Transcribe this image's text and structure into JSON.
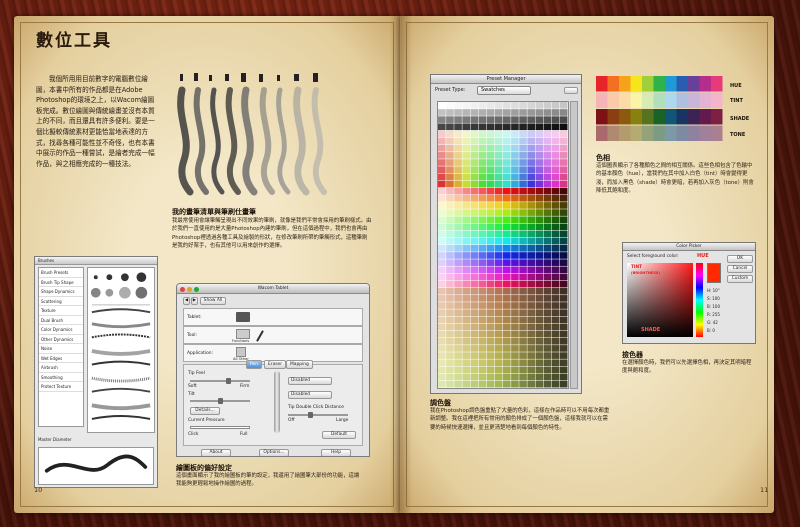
{
  "left_page": {
    "title": "數位工具",
    "intro": "我個所用用目前數字的電腦數位繪圖，本書中所有的作品都是在Adobe Photoshop的環境之上，以Wacom繪圖板完成。數位繪圖與傳統繪畫並沒有本質上的不同，而且還具有許多便利。要是一個比擬較傳統素材更能恰當地表達的方式，找尋各種可能性並不奇怪，也有本書中展示的作品一種嘗試，是繪者完成一幅作品，與之相應完成的一種技法。",
    "brush_caption_title": "我的畫筆清單與筆刷仕畫筆",
    "brush_caption_body": "我最常使用會讓筆觸呈現出不同效果的筆刷，就像是我們平常會採用的筆刷樣式。由於我們一直使用的是大量Photoshop內建的筆刷，但在這個過程中，我們也會再由Photoshop裡透過各種工具及繪製的形狀，在修改筆刷所帶的筆觸形式，這種筆刷是我的好幫手，也有其他可以用來創作的選擇。",
    "wacom_caption_title": "繪圖板的偏好設定",
    "wacom_caption_body": "這個畫面顯示了我的繪圖板的筆的設定，我還用了繪圖筆大部份的功能，這讓我能夠更輕鬆地操作繪圖的過程。",
    "page_number": "10"
  },
  "brush_panel": {
    "title": "Brushes",
    "items": [
      "Brush Presets",
      "Brush Tip Shape",
      "Shape Dynamics",
      "Scattering",
      "Texture",
      "Dual Brush",
      "Color Dynamics",
      "Other Dynamics",
      "Noise",
      "Wet Edges",
      "Airbrush",
      "Smoothing",
      "Protect Texture"
    ],
    "diameter_label": "Master Diameter"
  },
  "wacom": {
    "title": "Wacom Tablet",
    "show_all": "Show All",
    "row_labels": [
      "Tablet:",
      "Tool:",
      "Application:"
    ],
    "tool_name": "Functions",
    "app_name": "All Other",
    "tabs": [
      "Pen",
      "Eraser",
      "Mapping"
    ],
    "tip_feel": "Tip Feel",
    "soft": "Soft",
    "firm": "Firm",
    "tilt": "Tilt",
    "details": "Details...",
    "current_pressure": "Current Pressure",
    "click": "Click",
    "full": "Full",
    "dropdown_1": "Disabled",
    "dropdown_2": "Disabled",
    "double_click": "Tip Double Click Distance",
    "off": "Off",
    "large": "Large",
    "default": "Default",
    "about": "About",
    "options": "Options...",
    "help": "Help"
  },
  "right_page": {
    "palette_caption_title": "調色盤",
    "palette_caption_body": "我在Photoshop調色盤重點了大量的色彩，這樣在作品時可以不用每次都重新調整。我在這裡把所有常用的顏色排成了一個顏色盤，這樣我就可以在需要的時候快速選擇，並且更清楚地看到每個顏色的特性。",
    "colorchart_caption_title": "色相",
    "colorchart_caption_body": "這個圖表顯示了各種顏色之間的相互關係。這些色相包含了色輪中的基本顏色（hue），當我們在其中加入白色（tint）時會變得更淺，而加入黑色（shade）時會更暗，若再加入灰色（tone）則會降低其飽和度。",
    "picker_caption_title": "撿色器",
    "picker_caption_body": "在選擇顏色時，我們可以先選擇色相，再決定其明暗程度與飽和度。",
    "page_number": "11"
  },
  "preset_manager": {
    "title": "Preset Manager",
    "type_label": "Preset Type:",
    "type_value": "Swatches"
  },
  "color_chart": {
    "labels": [
      "HUE",
      "TINT",
      "SHADE",
      "TONE"
    ],
    "hue": [
      "#e8242b",
      "#f36f22",
      "#f7a21b",
      "#f6e51a",
      "#9fcf3a",
      "#2db34a",
      "#1e9bd7",
      "#2a5db0",
      "#6a3f99",
      "#b52e8c",
      "#e63b7a"
    ],
    "tint": [
      "#f6b4b6",
      "#fbcaa8",
      "#fcdca6",
      "#fbf3a6",
      "#d7ebb4",
      "#b1dfbd",
      "#aed8ef",
      "#aebfe0",
      "#c8b6da",
      "#e3b3d4",
      "#f4b5cc"
    ],
    "shade": [
      "#7d1216",
      "#8a3e12",
      "#8b5a0f",
      "#8a800f",
      "#57731f",
      "#196328",
      "#0f5678",
      "#173463",
      "#3b2355",
      "#651a4e",
      "#7e2043"
    ],
    "tone": [
      "#a86a6c",
      "#b08a6f",
      "#b39b6e",
      "#b3ab70",
      "#93a27a",
      "#7d9a85",
      "#7d99a8",
      "#7d8aa2",
      "#8e829e",
      "#a0809a",
      "#aa7f8f"
    ]
  },
  "color_picker": {
    "title": "Color Picker",
    "field_label": "Select foreground color:",
    "hue_label": "HUE",
    "tint_label": "TINT",
    "tint_sub": "(BRIGHTNESS)",
    "shade_label": "SHADE",
    "ok": "OK",
    "cancel": "Cancel",
    "custom": "Custom",
    "fields": [
      "H:",
      "S:",
      "B:",
      "R:",
      "G:",
      "B:"
    ],
    "values": [
      "10°",
      "100",
      "100",
      "255",
      "42",
      "0"
    ]
  }
}
